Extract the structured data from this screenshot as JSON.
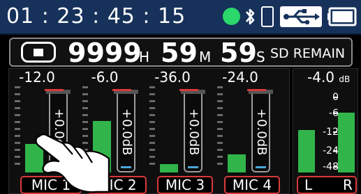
{
  "status": {
    "timecode": "01 : 23 : 45 : 15",
    "record_status_color": "#2bd86a",
    "bluetooth_icon": "bluetooth-icon",
    "device_icon": "phone-icon",
    "usb_icon": "usb-icon",
    "battery_icon": "battery-icon",
    "bar_color": "#16315a"
  },
  "remain": {
    "hours": "9999",
    "hours_unit": "H",
    "minutes": "59",
    "minutes_unit": "M",
    "seconds": "59",
    "seconds_unit": "S",
    "label": "SD REMAIN"
  },
  "channels": [
    {
      "level_db": "-12.0",
      "fader_label": "+0.0dB",
      "name": "MIC 1",
      "meter_fraction": 0.34
    },
    {
      "level_db": "-6.0",
      "fader_label": "+0.0dB",
      "name": "MIC 2",
      "meter_fraction": 0.62
    },
    {
      "level_db": "-36.0",
      "fader_label": "+0.0dB",
      "name": "MIC 3",
      "meter_fraction": 0.1
    },
    {
      "level_db": "-24.0",
      "fader_label": "+0.0dB",
      "name": "MIC 4",
      "meter_fraction": 0.22
    }
  ],
  "master": {
    "level_db": "-4.0",
    "unit": "dB",
    "scale": [
      "0",
      "-6",
      "-12",
      "-24",
      "-48"
    ],
    "left_label": "L",
    "right_label": "R",
    "left_fraction": 0.55,
    "right_fraction": 0.78
  },
  "colors": {
    "meter_green": "#31b54a",
    "label_border_red": "#d83a3a",
    "fader_blue": "#4aa6d8"
  }
}
